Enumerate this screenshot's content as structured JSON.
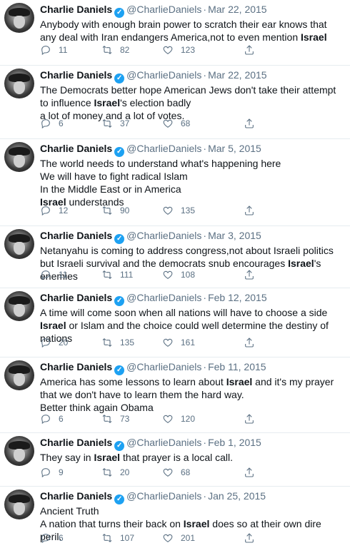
{
  "tweets": [
    {
      "name": "Charlie Daniels",
      "handle": "@CharlieDaniels",
      "date": "Mar 22, 2015",
      "parts": [
        "Anybody with enough brain power to scratch their ear knows that any deal with Iran endangers America,not to even mention ",
        "Israel",
        ""
      ],
      "replies": "11",
      "retweets": "82",
      "likes": "123"
    },
    {
      "name": "Charlie Daniels",
      "handle": "@CharlieDaniels",
      "date": "Mar 22, 2015",
      "parts": [
        "The Democrats better hope American Jews don't take their attempt to influence ",
        "Israel",
        "'s election badly\n a lot of money and a lot of votes."
      ],
      "replies": "6",
      "retweets": "37",
      "likes": "68"
    },
    {
      "name": "Charlie Daniels",
      "handle": "@CharlieDaniels",
      "date": "Mar 5, 2015",
      "parts": [
        "The world needs to understand what's happening here\nWe will have to fight radical Islam\nIn the Middle East or in America\n",
        "Israel",
        " understands"
      ],
      "replies": "12",
      "retweets": "90",
      "likes": "135"
    },
    {
      "name": "Charlie Daniels",
      "handle": "@CharlieDaniels",
      "date": "Mar 3, 2015",
      "parts": [
        "Netanyahu is coming to address congress,not about Israeli politics but Israeli survival and the democrats snub encourages ",
        "Israel",
        "'s enemies"
      ],
      "replies": "11",
      "retweets": "111",
      "likes": "108"
    },
    {
      "name": "Charlie Daniels",
      "handle": "@CharlieDaniels",
      "date": "Feb 12, 2015",
      "parts": [
        "A time will come soon when all nations will have to choose a side\n",
        "Israel",
        " or Islam and the choice could well determine the destiny of nations"
      ],
      "replies": "20",
      "retweets": "135",
      "likes": "161"
    },
    {
      "name": "Charlie Daniels",
      "handle": "@CharlieDaniels",
      "date": "Feb 11, 2015",
      "parts": [
        "America has some lessons to learn about ",
        "Israel",
        " and it's my prayer that we don't have to learn them the hard way.\nBetter think again Obama"
      ],
      "replies": "6",
      "retweets": "73",
      "likes": "120"
    },
    {
      "name": "Charlie Daniels",
      "handle": "@CharlieDaniels",
      "date": "Feb 1, 2015",
      "parts": [
        "They say in ",
        "Israel",
        " that prayer is a local call."
      ],
      "replies": "9",
      "retweets": "20",
      "likes": "68"
    },
    {
      "name": "Charlie Daniels",
      "handle": "@CharlieDaniels",
      "date": "Jan 25, 2015",
      "parts": [
        "Ancient Truth\nA nation that turns their back on ",
        "Israel",
        " does so at their own dire peril."
      ],
      "replies": "6",
      "retweets": "107",
      "likes": "201"
    }
  ],
  "icons": {
    "reply": "reply-icon",
    "retweet": "retweet-icon",
    "like": "heart-icon",
    "share": "share-icon",
    "verified": "verified-badge-icon"
  },
  "colors": {
    "verified": "#1da1f2",
    "muted": "#5b7083",
    "divider": "#e6ecf0"
  }
}
